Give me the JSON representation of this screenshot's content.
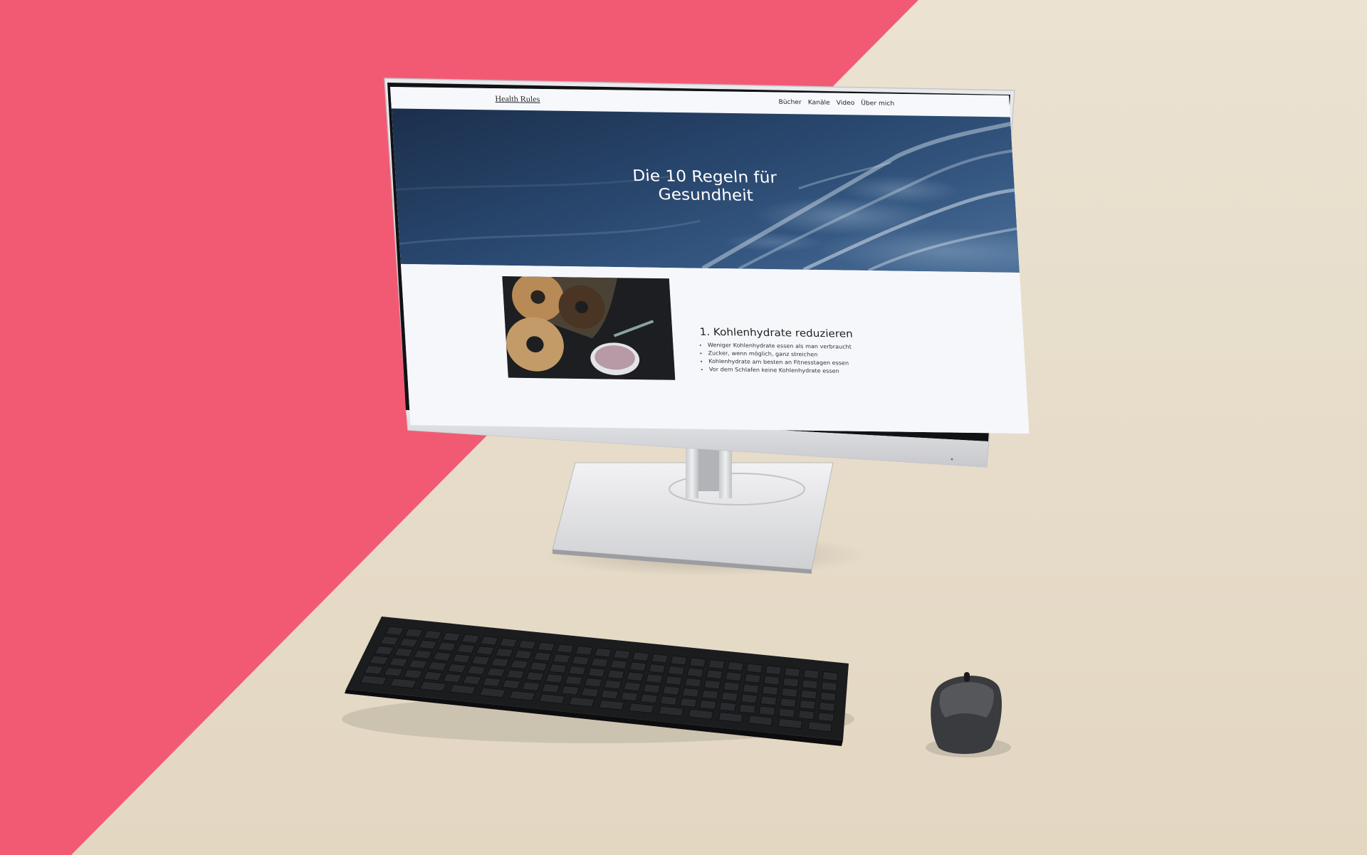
{
  "site": {
    "brand": "Health Rules",
    "nav": [
      "Bücher",
      "Kanäle",
      "Video",
      "Über mich"
    ],
    "hero_title_line1": "Die 10 Regeln für",
    "hero_title_line2": "Gesundheit",
    "rule": {
      "title": "1. Kohlenhydrate reduzieren",
      "items": [
        "Weniger Kohlenhydrate essen als man verbraucht",
        "Zucker, wenn möglich, ganz streichen",
        "Kohlenhydrate am besten an Fitnesstagen essen",
        "Vor dem Schlafen keine Kohlenhydrate essen"
      ]
    }
  },
  "icons": {
    "food": "bagel-photo",
    "hero": "ocean-waves-photo"
  },
  "colors": {
    "background_pink": "#f25a74",
    "background_beige": "#e9dfcd",
    "hero_blue": "#27446a",
    "monitor_silver": "#d9dade"
  }
}
